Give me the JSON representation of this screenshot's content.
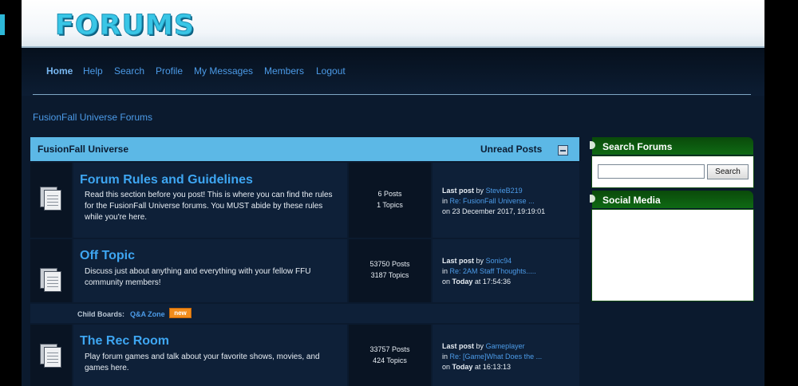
{
  "header": {
    "logo_text": "FORUMS"
  },
  "nav": {
    "items": [
      "Home",
      "Help",
      "Search",
      "Profile",
      "My Messages",
      "Members",
      "Logout"
    ]
  },
  "breadcrumb": "FusionFall Universe Forums",
  "board": {
    "title": "FusionFall Universe",
    "unread_label": "Unread Posts",
    "forums": [
      {
        "title": "Forum Rules and Guidelines",
        "desc": "Read this section before you post! This is where you can find the rules for the FusionFall Universe forums. You MUST abide by these rules while you're here.",
        "posts": "6 Posts",
        "topics": "1 Topics",
        "last_label": "Last post",
        "by": "by",
        "last_author": "StevieB219",
        "in": "in",
        "last_topic": "Re: FusionFall Universe ...",
        "on": "on",
        "last_time": "23 December 2017, 19:19:01"
      },
      {
        "title": "Off Topic",
        "desc": "Discuss just about anything and everything with your fellow FFU community members!",
        "posts": "53750 Posts",
        "topics": "3187 Topics",
        "last_label": "Last post",
        "by": "by",
        "last_author": "Sonic94",
        "in": "in",
        "last_topic": "Re: 2AM Staff Thoughts.....",
        "on": "on",
        "today": "Today",
        "at": "at",
        "last_time": "17:54:36"
      },
      {
        "title": "The Rec Room",
        "desc": "Play forum games and talk about your favorite shows, movies, and games here.",
        "posts": "33757 Posts",
        "topics": "424 Topics",
        "last_label": "Last post",
        "by": "by",
        "last_author": "Gameplayer",
        "in": "in",
        "last_topic": "Re: [Game]What Does the ...",
        "on": "on",
        "today": "Today",
        "at": "at",
        "last_time": "16:13:13"
      }
    ],
    "child_boards": {
      "label": "Child Boards:",
      "link": "Q&A Zone",
      "badge": "new"
    }
  },
  "sidebar": {
    "search": {
      "title": "Search Forums",
      "button": "Search",
      "value": ""
    },
    "social": {
      "title": "Social Media"
    }
  },
  "colors": {
    "accent": "#4c9be8",
    "header_bar": "#5cb8e6",
    "sidebar_head": "#0f6a14",
    "badge": "#f28c1b"
  }
}
